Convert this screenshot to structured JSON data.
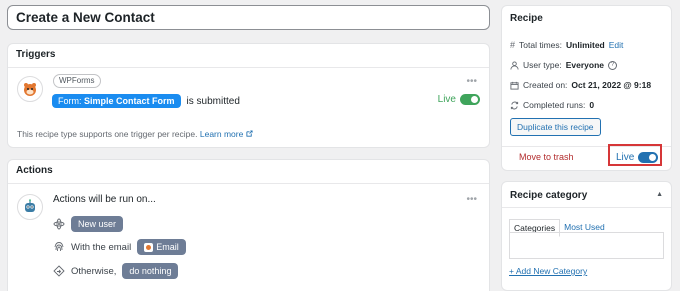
{
  "title_input": {
    "value": "Create a New Contact"
  },
  "triggers": {
    "heading": "Triggers",
    "integration_chip": "WPForms",
    "form_pill_prefix": "Form:",
    "form_pill_value": "Simple Contact Form",
    "trigger_suffix": "is submitted",
    "live_label": "Live",
    "live_on": true,
    "note": "This recipe type supports one trigger per recipe.",
    "learn_more": "Learn more",
    "menu_glyph": "•••"
  },
  "actions": {
    "heading": "Actions",
    "intro": "Actions will be run on...",
    "row1_pill": "New user",
    "row2_text": "With the email",
    "row2_pill": "Email",
    "row3_text": "Otherwise,",
    "row3_pill": "do nothing",
    "menu_glyph": "•••"
  },
  "recipe": {
    "heading": "Recipe",
    "total_times_label": "Total times:",
    "total_times_value": "Unlimited",
    "total_times_edit": "Edit",
    "user_type_label": "User type:",
    "user_type_value": "Everyone",
    "created_label": "Created on:",
    "created_value": "Oct 21, 2022 @ 9:18",
    "completed_label": "Completed runs:",
    "completed_value": "0",
    "duplicate_label": "Duplicate this recipe",
    "trash_label": "Move to trash",
    "live_label": "Live",
    "live_on": true
  },
  "category": {
    "heading": "Recipe category",
    "tab_categories": "Categories",
    "tab_most_used": "Most Used",
    "add_new": "+ Add New Category"
  },
  "colors": {
    "accent_blue": "#2271b1",
    "pill_blue": "#1a8cf0",
    "live_green": "#3fa45b",
    "recipe_toggle": "#2271b1",
    "trash_red": "#b32d2e",
    "highlight_red": "#d63638"
  },
  "icons": {
    "trigger_avatar": "wpforms-bear-icon",
    "action_avatar": "uncanny-robot-icon",
    "total_times": "hash-icon",
    "user_type": "user-icon",
    "created": "calendar-icon",
    "completed": "refresh-icon",
    "external_link": "external-link-icon"
  }
}
